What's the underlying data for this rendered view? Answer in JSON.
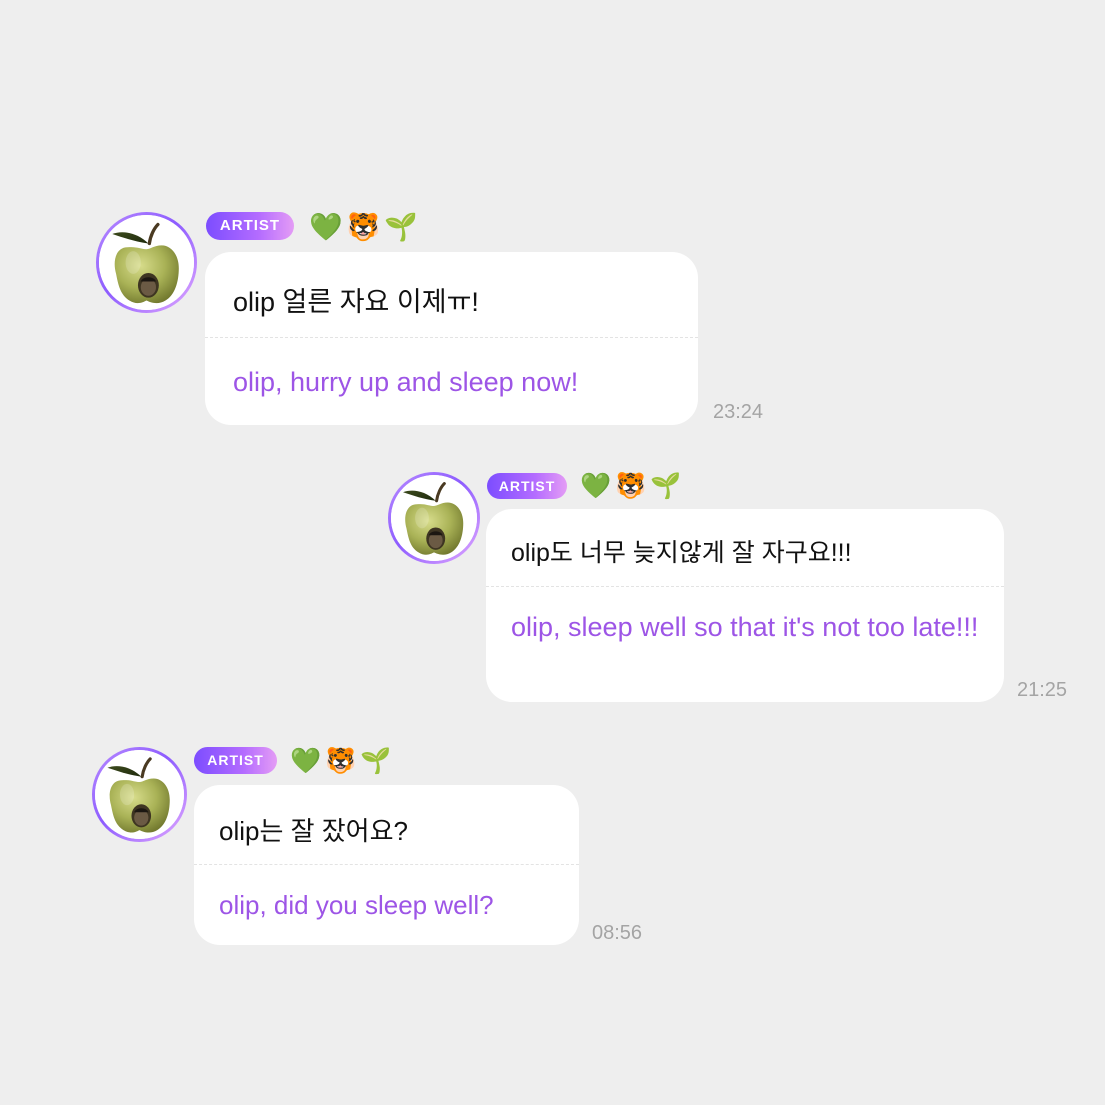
{
  "messages": [
    {
      "badge": "ARTIST",
      "emojis": [
        "💚",
        "🐯",
        "🌱"
      ],
      "original": "olip 얼른 자요 이제ㅠ!",
      "translation": "olip, hurry up and sleep now!",
      "time": "23:24"
    },
    {
      "badge": "ARTIST",
      "emojis": [
        "💚",
        "🐯",
        "🌱"
      ],
      "original": "olip도 너무 늦지않게 잘 자구요!!!",
      "translation": "olip, sleep well so that it's not too late!!!",
      "time": "21:25"
    },
    {
      "badge": "ARTIST",
      "emojis": [
        "💚",
        "🐯",
        "🌱"
      ],
      "original": "olip는 잘 잤어요?",
      "translation": "olip, did you sleep well?",
      "time": "08:56"
    }
  ],
  "icons": {
    "avatar": "green-apple-avatar-icon",
    "emoji_1": "green-heart-icon",
    "emoji_2": "tiger-face-icon",
    "emoji_3": "seedling-icon"
  },
  "colors": {
    "background": "#eeeeee",
    "bubble": "#ffffff",
    "translation_text": "#9d55e6",
    "badge_gradient_start": "#7c4dff",
    "badge_gradient_end": "#e49cf5",
    "timestamp": "#a4a4a4"
  }
}
